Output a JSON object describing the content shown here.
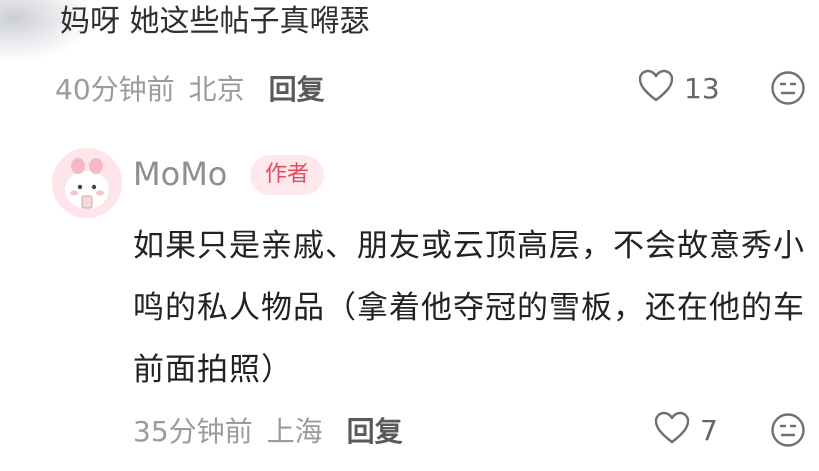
{
  "top_comment": {
    "text": "妈呀 她这些帖子真嘚瑟",
    "time": "40分钟前",
    "location": "北京",
    "reply_label": "回复",
    "like_count": "13"
  },
  "reply_comment": {
    "author": "MoMo",
    "badge": "作者",
    "text": "如果只是亲戚、朋友或云顶高层，不会故意秀小鸣的私人物品（拿着他夺冠的雪板，还在他的车前面拍照）",
    "time": "35分钟前",
    "location": "上海",
    "reply_label": "回复",
    "like_count": "7"
  },
  "icons": {
    "like": "heart-outline-icon",
    "dislike": "neutral-face-icon"
  },
  "colors": {
    "badge_text": "#e64a5f",
    "badge_bg": "#fde9ec",
    "meta": "#9b9b9b"
  }
}
